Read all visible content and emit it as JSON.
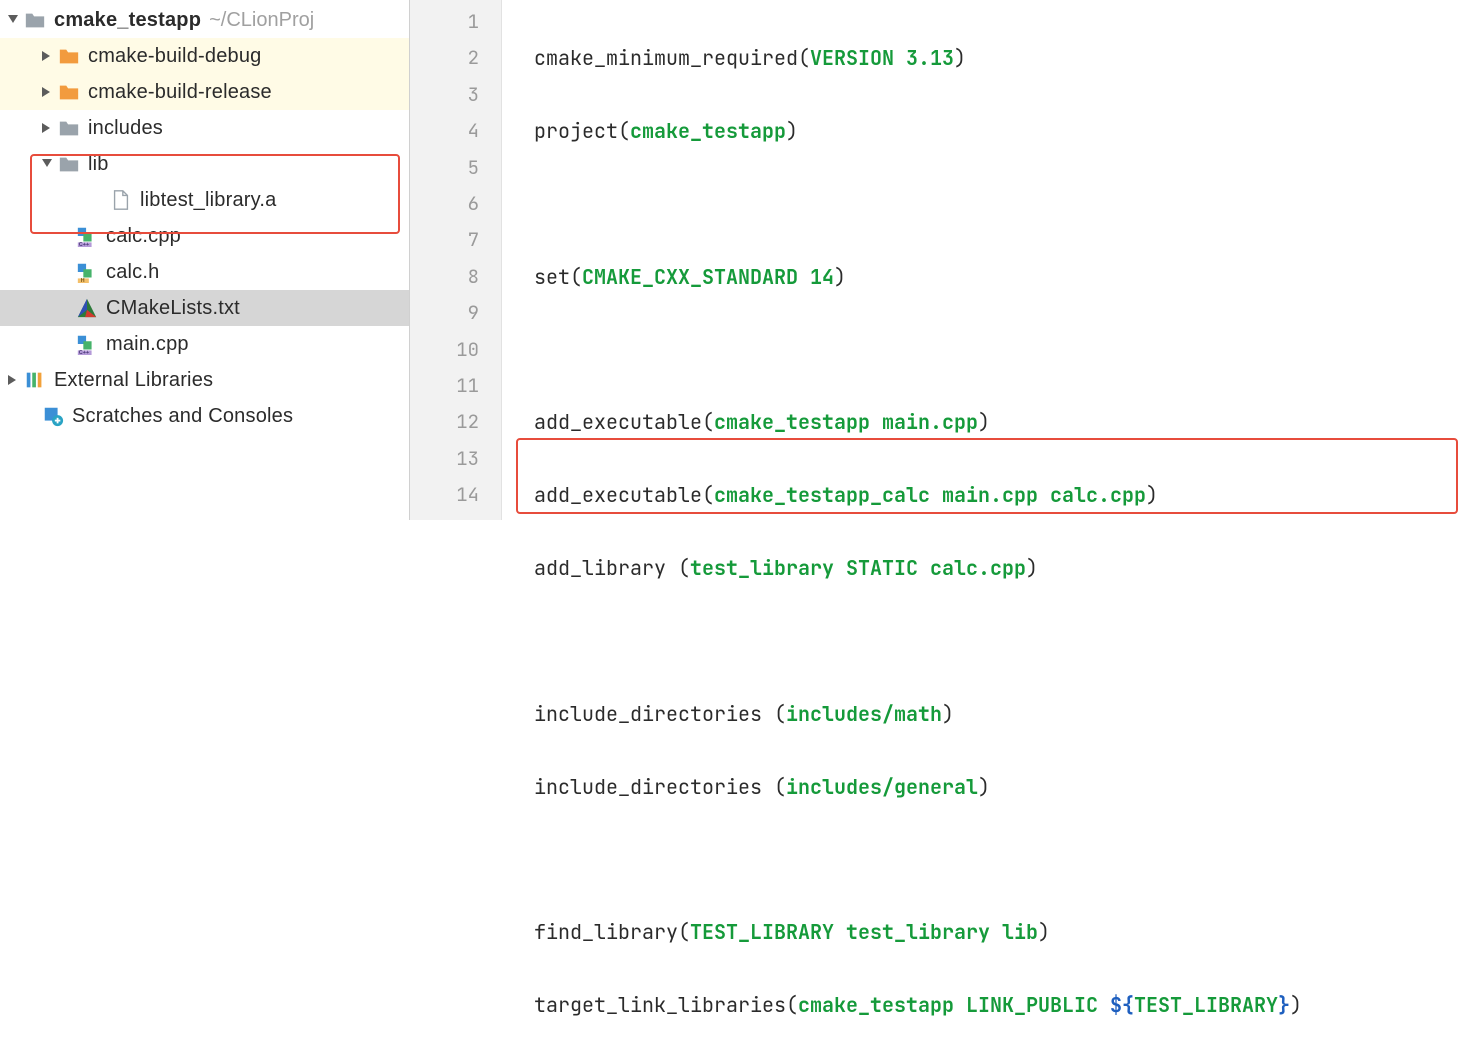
{
  "tree": {
    "root": {
      "name": "cmake_testapp",
      "path": "~/CLionProj"
    },
    "items": [
      {
        "name": "cmake-build-debug"
      },
      {
        "name": "cmake-build-release"
      },
      {
        "name": "includes"
      },
      {
        "name": "lib"
      },
      {
        "name": "libtest_library.a"
      },
      {
        "name": "calc.cpp"
      },
      {
        "name": "calc.h"
      },
      {
        "name": "CMakeLists.txt"
      },
      {
        "name": "main.cpp"
      }
    ],
    "external": "External Libraries",
    "scratches": "Scratches and Consoles"
  },
  "code": {
    "l1_a": "cmake_minimum_required(",
    "l1_b": "VERSION 3.13",
    "l1_c": ")",
    "l2_a": "project(",
    "l2_b": "cmake_testapp",
    "l2_c": ")",
    "l4_a": "set(",
    "l4_b": "CMAKE_CXX_STANDARD 14",
    "l4_c": ")",
    "l6_a": "add_executable(",
    "l6_b": "cmake_testapp main.cpp",
    "l6_c": ")",
    "l7_a": "add_executable(",
    "l7_b": "cmake_testapp_calc main.cpp calc.cpp",
    "l7_c": ")",
    "l8_a": "add_library (",
    "l8_b": "test_library STATIC calc.cpp",
    "l8_c": ")",
    "l10_a": "include_directories (",
    "l10_b": "includes/math",
    "l10_c": ")",
    "l11_a": "include_directories (",
    "l11_b": "includes/general",
    "l11_c": ")",
    "l13_a": "find_library(",
    "l13_b": "TEST_LIBRARY test_library lib",
    "l13_c": ")",
    "l14_a": "target_link_libraries(",
    "l14_b": "cmake_testapp LINK_PUBLIC ",
    "l14_c": "${",
    "l14_d": "TEST_LIBRARY",
    "l14_e": "}",
    "l14_f": ")"
  },
  "gutter": [
    "1",
    "2",
    "3",
    "4",
    "5",
    "6",
    "7",
    "8",
    "9",
    "10",
    "11",
    "12",
    "13",
    "14"
  ]
}
